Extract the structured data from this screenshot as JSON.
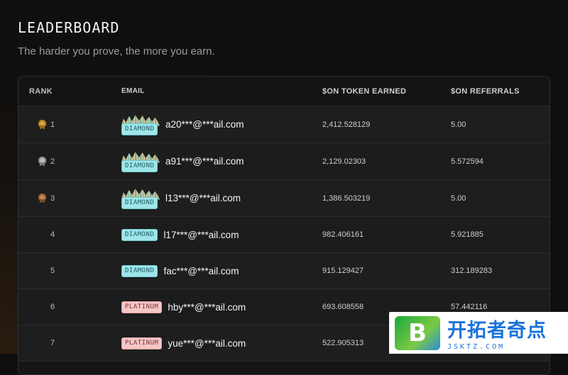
{
  "header": {
    "title": "LEADERBOARD",
    "subtitle": "The harder you prove, the more you earn."
  },
  "table": {
    "columns": [
      "RANK",
      "EMAIL",
      "$ON TOKEN EARNED",
      "$ON REFERRALS"
    ],
    "rows": [
      {
        "rank": "1",
        "medal": "gold",
        "tier": "DIAMOND",
        "email": "a20***@***ail.com",
        "tokens": "2,412.528129",
        "referrals": "5.00"
      },
      {
        "rank": "2",
        "medal": "silver",
        "tier": "DIAMOND",
        "email": "a91***@***ail.com",
        "tokens": "2,129.02303",
        "referrals": "5.572594"
      },
      {
        "rank": "3",
        "medal": "bronze",
        "tier": "DIAMOND",
        "email": "l13***@***ail.com",
        "tokens": "1,386.503219",
        "referrals": "5.00"
      },
      {
        "rank": "4",
        "tier": "DIAMOND",
        "email": "l17***@***ail.com",
        "tokens": "982.406161",
        "referrals": "5.921885"
      },
      {
        "rank": "5",
        "tier": "DIAMOND",
        "email": "fac***@***ail.com",
        "tokens": "915.129427",
        "referrals": "312.189283"
      },
      {
        "rank": "6",
        "tier": "PLATINUM",
        "email": "hby***@***ail.com",
        "tokens": "693.608558",
        "referrals": "57.442116"
      },
      {
        "rank": "7",
        "tier": "PLATINUM",
        "email": "yue***@***ail.com",
        "tokens": "522.905313",
        "referrals": ""
      }
    ]
  },
  "watermark": {
    "mark": "B",
    "name": "开拓者奇点",
    "url": "JSKTZ.COM"
  },
  "icons": {
    "medal_gold": "gold-medal-icon",
    "medal_silver": "silver-medal-icon",
    "medal_bronze": "bronze-medal-icon"
  }
}
